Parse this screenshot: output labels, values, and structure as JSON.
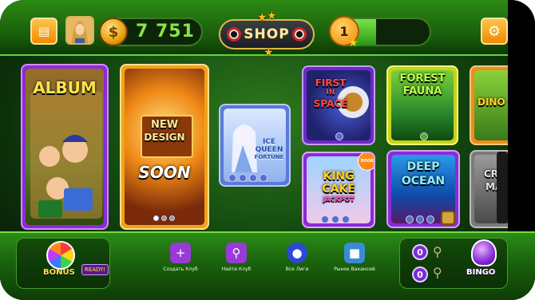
{
  "topbar": {
    "coins": "7 751",
    "shop_label": "SHOP",
    "level": "1",
    "level_progress": 0.45
  },
  "tiles": {
    "album": "ALBUM",
    "new_design_1": "NEW",
    "new_design_2": "DESIGN",
    "soon": "SOON",
    "ice_queen_1": "ICE",
    "ice_queen_2": "QUEEN",
    "ice_queen_3": "FORTUNE",
    "first_space_1": "FIRST",
    "first_space_2": "IN",
    "first_space_3": "SPACE",
    "king_cake_1": "KING",
    "king_cake_2": "CAKE",
    "king_cake_3": "JACKPOT",
    "book_badge": "BOOK",
    "forest_1": "FOREST",
    "forest_2": "FAUNA",
    "deep_1": "DEEP",
    "deep_2": "OCEAN",
    "dino": "DINO",
    "partial_1": "CR",
    "partial_2": "MA"
  },
  "bottombar": {
    "bonus_label": "BONUS",
    "ready_label": "READY!",
    "create_club": "Создать Клуб",
    "find_club": "Найти Клуб",
    "all_leagues": "Все Лиги",
    "vacancy_market": "Рынок Вакансий",
    "count_top": "0",
    "count_bottom": "0",
    "bingo_label": "BINGO"
  },
  "colors": {
    "accent_green": "#7cd943",
    "coin_text": "#8be24a",
    "gold": "#ffb81c"
  }
}
